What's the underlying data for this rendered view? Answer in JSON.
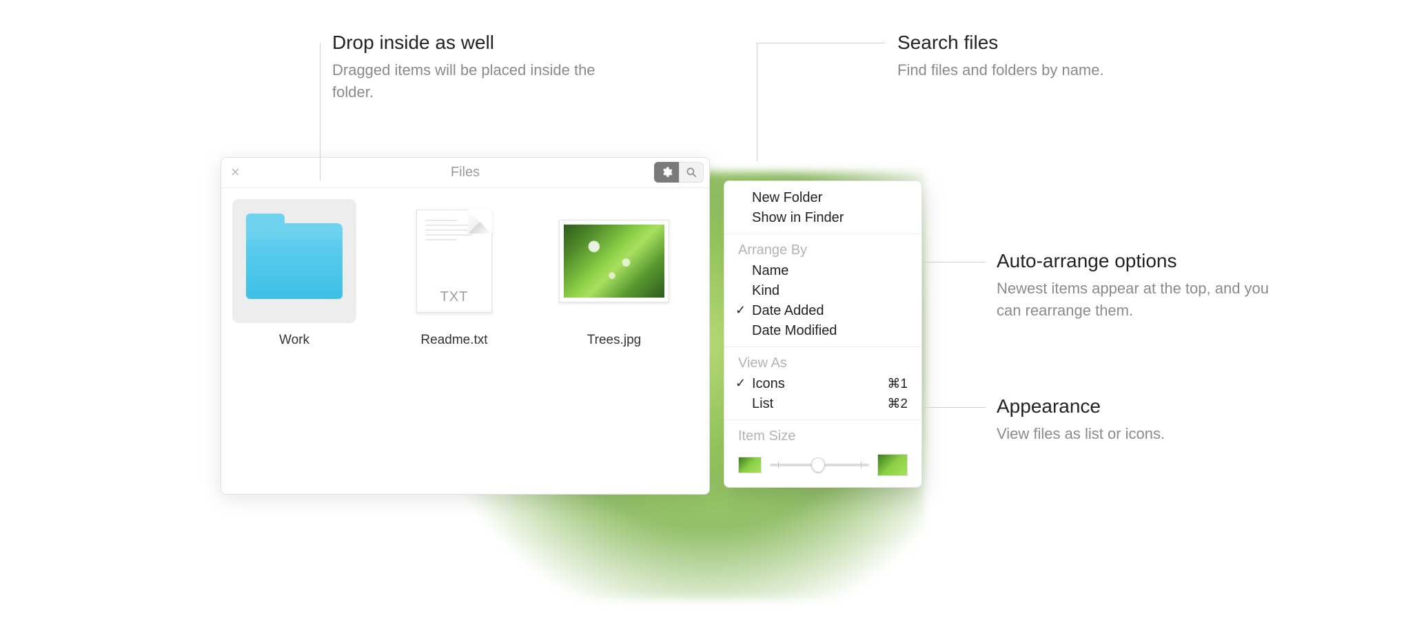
{
  "annotations": {
    "drop": {
      "title": "Drop inside as well",
      "desc": "Dragged items will be placed inside the folder."
    },
    "search": {
      "title": "Search files",
      "desc": "Find files and folders by name."
    },
    "arrange": {
      "title": "Auto-arrange options",
      "desc": "Newest items appear at the top, and you can rearrange them."
    },
    "appearance": {
      "title": "Appearance",
      "desc": "View files as list or icons."
    }
  },
  "panel": {
    "title": "Files",
    "items": [
      {
        "label": "Work",
        "kind": "folder",
        "selected": true
      },
      {
        "label": "Readme.txt",
        "kind": "txt",
        "selected": false,
        "ext": "TXT"
      },
      {
        "label": "Trees.jpg",
        "kind": "image",
        "selected": false
      }
    ]
  },
  "menu": {
    "top": [
      "New Folder",
      "Show in Finder"
    ],
    "arrange_label": "Arrange By",
    "arrange": [
      {
        "label": "Name",
        "checked": false
      },
      {
        "label": "Kind",
        "checked": false
      },
      {
        "label": "Date Added",
        "checked": true
      },
      {
        "label": "Date Modified",
        "checked": false
      }
    ],
    "view_label": "View As",
    "view": [
      {
        "label": "Icons",
        "shortcut": "⌘1",
        "checked": true
      },
      {
        "label": "List",
        "shortcut": "⌘2",
        "checked": false
      }
    ],
    "size_label": "Item Size"
  }
}
